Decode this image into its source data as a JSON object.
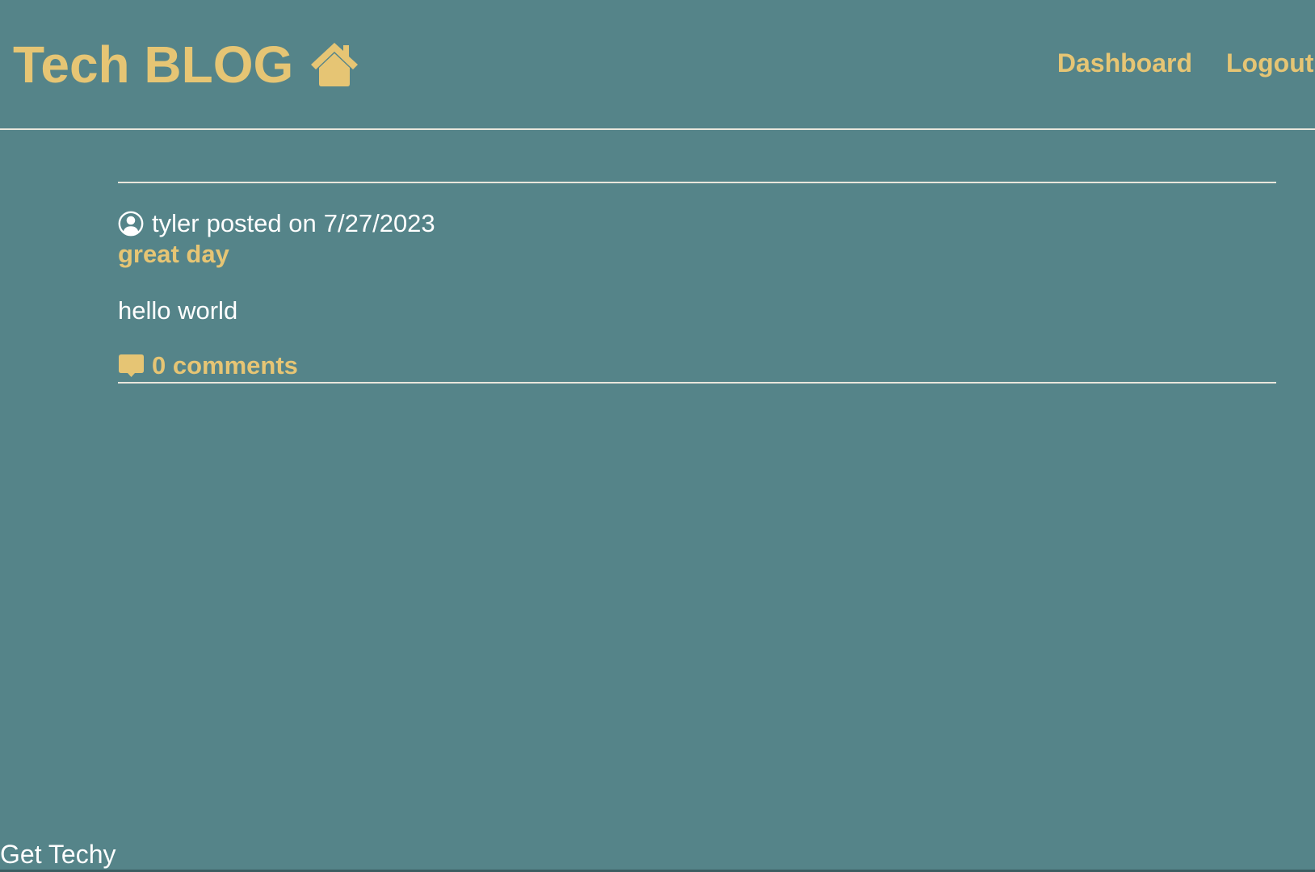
{
  "header": {
    "brand_title": "Tech BLOG",
    "brand_icon": "home-icon",
    "nav": {
      "dashboard_label": "Dashboard",
      "logout_label": "Logout"
    }
  },
  "post": {
    "author": "tyler",
    "posted_on_label": "posted on",
    "date": "7/27/2023",
    "title": "great day",
    "body": "hello world",
    "comments_label": "0 comments",
    "author_icon": "user-circle-icon",
    "comments_icon": "comment-icon"
  },
  "footer": {
    "text": "Get Techy"
  },
  "colors": {
    "background": "#558489",
    "accent": "#e6c574",
    "text": "#ffffff",
    "rule": "#e9e6dc"
  }
}
